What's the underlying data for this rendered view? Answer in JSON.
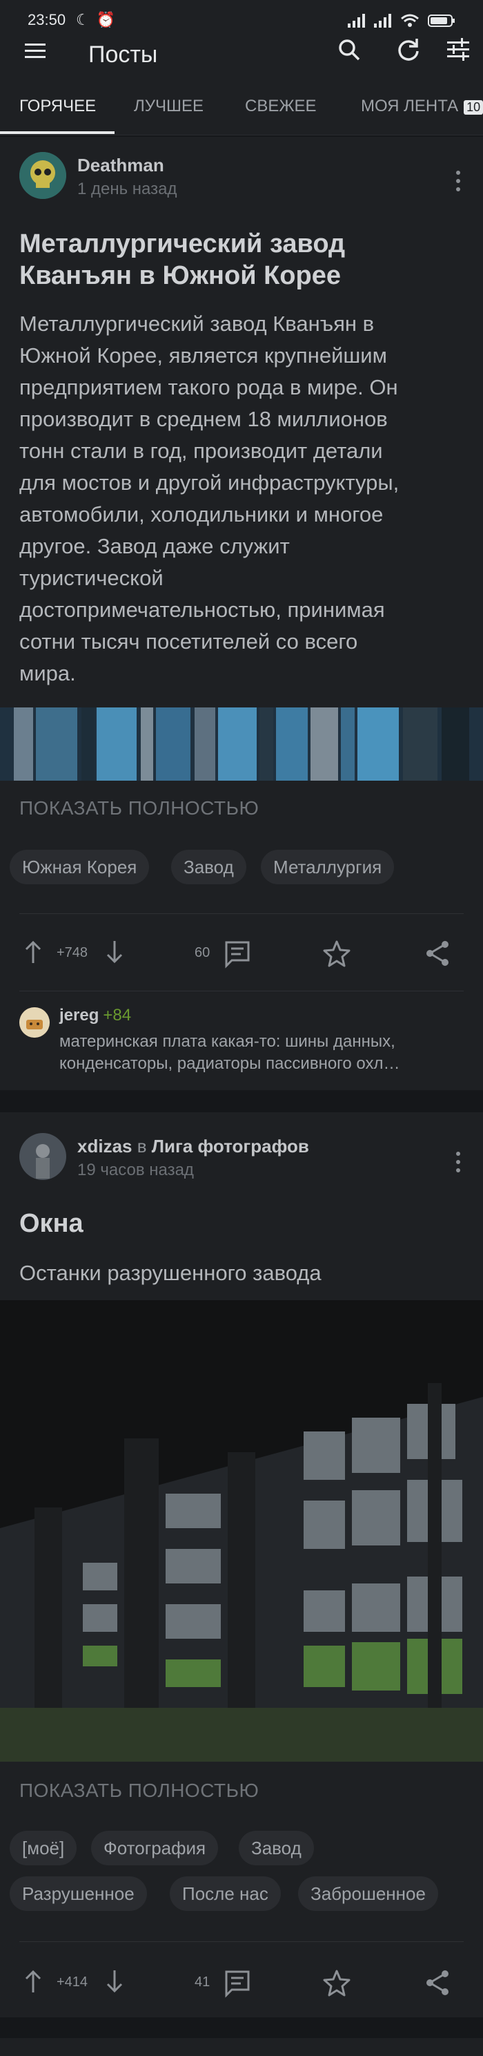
{
  "status_bar": {
    "time": "23:50",
    "left_icons": "☾ ⏰"
  },
  "app_bar": {
    "title": "Посты"
  },
  "tabs": [
    {
      "label": "ГОРЯЧЕЕ"
    },
    {
      "label": "ЛУЧШЕЕ"
    },
    {
      "label": "СВЕЖЕЕ"
    },
    {
      "label": "МОЯ ЛЕНТА",
      "badge": "10"
    }
  ],
  "posts": [
    {
      "author": "Deathman",
      "community_prefix": "",
      "community": "",
      "time": "1 день назад",
      "title_lines": [
        "Металлургический завод",
        "Кванъян в Южной Корее"
      ],
      "text_lines": [
        "Металлургический завод Кванъян в",
        "Южной Корее, является крупнейшим",
        "предприятием такого рода в мире. Он",
        "производит в среднем 18 миллионов",
        "тонн стали в год, производит детали",
        "для мостов и другой инфраструктуры,",
        "автомобили, холодильники и многое",
        "другое. Завод даже служит",
        "туристической",
        "достопримечательностью, принимая",
        "сотни тысяч посетителей со всего",
        "мира."
      ],
      "show_full": "ПОКАЗАТЬ ПОЛНОСТЬЮ",
      "tags": [
        "Южная Корея",
        "Завод",
        "Металлургия"
      ],
      "rating": "+748",
      "comments": "60",
      "top_comment": {
        "author": "jereg",
        "rating": "+84",
        "text_lines": [
          "материнская плата какая-то: шины данных,",
          "конденсаторы, радиаторы пассивного охл…"
        ]
      }
    },
    {
      "author": "xdizas",
      "community_prefix": "в",
      "community": "Лига фотографов",
      "time": "19 часов назад",
      "title_lines": [
        "Окна"
      ],
      "text_lines": [
        "Останки разрушенного завода"
      ],
      "show_full": "ПОКАЗАТЬ ПОЛНОСТЬЮ",
      "tags": [
        "[моё]",
        "Фотография",
        "Завод",
        "Разрушенное",
        "После нас",
        "Заброшенное"
      ],
      "rating": "+414",
      "comments": "41"
    }
  ],
  "colors": {
    "background": "#15171a",
    "card": "#1e2023",
    "accent_green": "#6a9a2f",
    "text_primary": "#e6e8ea"
  },
  "icons": [
    "menu-icon",
    "search-icon",
    "refresh-icon",
    "filter-icon",
    "more-vertical-icon",
    "arrow-up-icon",
    "arrow-down-icon",
    "comment-icon",
    "star-icon",
    "share-icon"
  ]
}
